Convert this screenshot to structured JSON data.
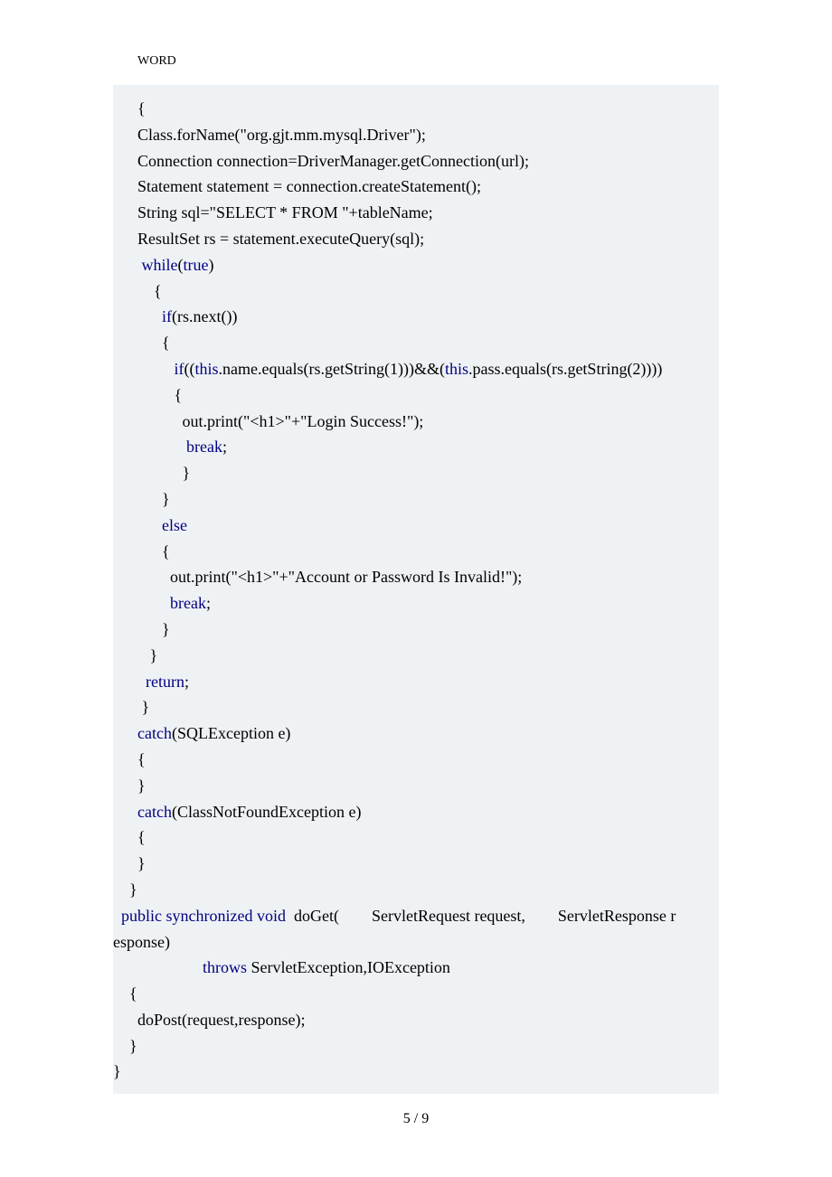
{
  "header": "WORD",
  "footer": "5  / 9",
  "code": {
    "l01": "      {",
    "l02": "      Class.forName(\"org.gjt.mm.mysql.Driver\");",
    "l03": "      Connection connection=DriverManager.getConnection(url);",
    "l04": "      Statement statement = connection.createStatement();",
    "l05": "      String sql=\"SELECT * FROM \"+tableName;",
    "l06": "      ResultSet rs = statement.executeQuery(sql);",
    "l07": "",
    "l08a": "       ",
    "l08b": "while",
    "l08c": "(",
    "l08d": "true",
    "l08e": ")",
    "l09": "          {",
    "l10a": "            ",
    "l10b": "if",
    "l10c": "(rs.next())",
    "l11": "            {",
    "l12a": "               ",
    "l12b": "if",
    "l12c": "((",
    "l12d": "this",
    "l12e": ".name.equals(rs.getString(1)))&&(",
    "l12f": "this",
    "l12g": ".pass.equals(rs.getString(2))))",
    "l13": "               {",
    "l14": "",
    "l15": "                 out.print(\"<h1>\"+\"Login Success!\");",
    "l16": "",
    "l17a": "                  ",
    "l17b": "break",
    "l17c": ";",
    "l18": "                 }",
    "l19": "            }",
    "l20a": "            ",
    "l20b": "else",
    "l21": "            {",
    "l22": "              out.print(\"<h1>\"+\"Account or Password Is Invalid!\");",
    "l23a": "              ",
    "l23b": "break",
    "l23c": ";",
    "l24": "            }",
    "l25": "         }",
    "l26a": "        ",
    "l26b": "return",
    "l26c": ";",
    "l27": "       }",
    "l28a": "      ",
    "l28b": "catch",
    "l28c": "(SQLException e)",
    "l29": "      {",
    "l30": "      }",
    "l31a": "      ",
    "l31b": "catch",
    "l31c": "(ClassNotFoundException e)",
    "l32": "      {",
    "l33": "      }",
    "l34": "",
    "l35": "",
    "l36": "    }",
    "l37": "",
    "l38a": "  ",
    "l38b": "public",
    "l38c": " ",
    "l38d": "synchronized",
    "l38e": " ",
    "l38f": "void",
    "l38g": "  doGet(        ServletRequest request,        ServletResponse r",
    "l39": "esponse)",
    "l40a": "                      ",
    "l40b": "throws",
    "l40c": " ServletException,IOException",
    "l41": "    {",
    "l42": "      doPost(request,response);",
    "l43": "    }",
    "l44": "}"
  }
}
